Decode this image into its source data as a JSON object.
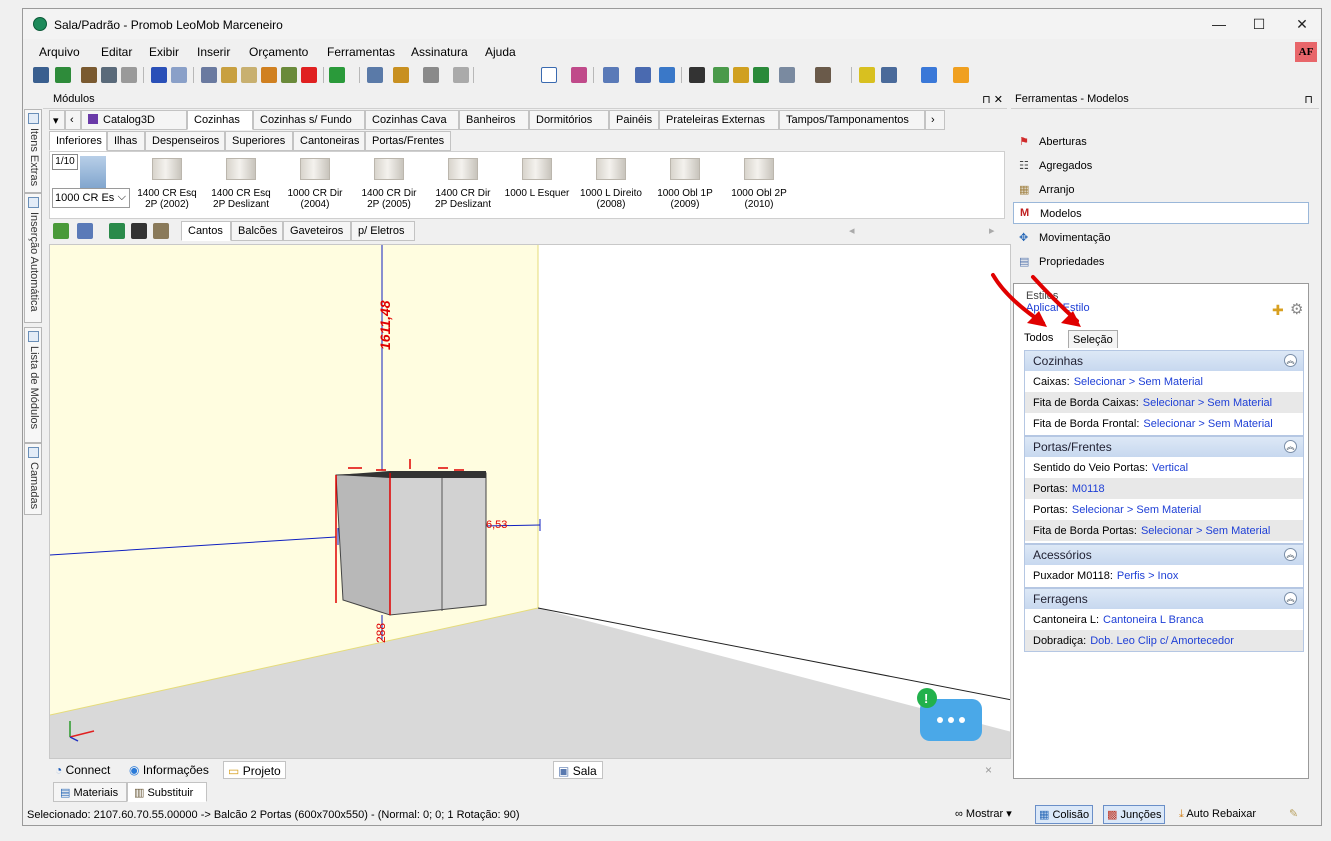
{
  "window": {
    "title": "Sala/Padrão - Promob LeoMob Marceneiro",
    "user_badge": "AF"
  },
  "menu": [
    "Arquivo",
    "Editar",
    "Exibir",
    "Inserir",
    "Orçamento",
    "Ferramentas",
    "Assinatura",
    "Ajuda"
  ],
  "modules_panel": {
    "title": "Módulos",
    "pin": "⊓ ✕"
  },
  "left_tabs": [
    "Itens Extras",
    "Inserção Automática",
    "Lista de Módulos",
    "Camadas"
  ],
  "catalog_tabs": [
    "Catalog3D",
    "Cozinhas",
    "Cozinhas s/ Fundo",
    "Cozinhas Cava",
    "Banheiros",
    "Dormitórios",
    "Painéis",
    "Prateleiras Externas",
    "Tampos/Tamponamentos"
  ],
  "sub_tabs": [
    "Inferiores",
    "Ilhas",
    "Despenseiros",
    "Superiores",
    "Cantoneiras",
    "Portas/Frentes"
  ],
  "page_indicator": "1/10",
  "module_select": "1000 CR Es",
  "thumbnails": [
    {
      "label": "1400 CR Esq 2P (2002)"
    },
    {
      "label": "1400 CR Esq 2P Deslizant"
    },
    {
      "label": "1000 CR Dir (2004)"
    },
    {
      "label": "1400 CR Dir 2P (2005)"
    },
    {
      "label": "1400 CR Dir 2P Deslizant"
    },
    {
      "label": "1000 L Esquer"
    },
    {
      "label": "1000 L Direito (2008)"
    },
    {
      "label": "1000 Obl 1P (2009)"
    },
    {
      "label": "1000 Obl 2P (2010)"
    }
  ],
  "filter_tabs": [
    "Cantos",
    "Balcões",
    "Gaveteiros",
    "p/ Eletros"
  ],
  "viewport": {
    "dim_vertical": "1611,48",
    "dim_horizontal": "6,53",
    "dim_bottom": "288"
  },
  "bottom_tabs": {
    "connect": "Connect",
    "info": "Informações",
    "project": "Projeto",
    "room": "Sala",
    "close": "×"
  },
  "lower_tabs": [
    "Materiais",
    "Substituir"
  ],
  "status": {
    "selected": "Selecionado: 2107.60.70.55.00000 -> Balcão 2 Portas (600x700x550) - (Normal: 0; 0; 1 Rotação: 90)",
    "show": "Mostrar",
    "collision": "Colisão",
    "joints": "Junções",
    "auto_lower": "Auto Rebaixar"
  },
  "tools_panel": {
    "title": "Ferramentas - Modelos",
    "items": [
      "Aberturas",
      "Agregados",
      "Arranjo",
      "Modelos",
      "Movimentação",
      "Propriedades"
    ],
    "styles_label": "Estilos",
    "apply_style": "Aplicar Estilo",
    "tabs": [
      "Todos",
      "Seleção"
    ],
    "groups": [
      {
        "title": "Cozinhas",
        "rows": [
          {
            "label": "Caixas:",
            "value": "Selecionar > Sem Material"
          },
          {
            "label": "Fita de Borda Caixas:",
            "value": "Selecionar > Sem Material"
          },
          {
            "label": "Fita de Borda Frontal:",
            "value": "Selecionar > Sem Material"
          }
        ]
      },
      {
        "title": "Portas/Frentes",
        "rows": [
          {
            "label": "Sentido do Veio Portas:",
            "value": "Vertical"
          },
          {
            "label": "Portas:",
            "value": "M0118"
          },
          {
            "label": "Portas:",
            "value": "Selecionar > Sem Material"
          },
          {
            "label": "Fita de Borda Portas:",
            "value": "Selecionar > Sem Material"
          }
        ]
      },
      {
        "title": "Acessórios",
        "rows": [
          {
            "label": "Puxador M0118:",
            "value": "Perfis > Inox"
          }
        ]
      },
      {
        "title": "Ferragens",
        "rows": [
          {
            "label": "Cantoneira L:",
            "value": "Cantoneira L Branca"
          },
          {
            "label": "Dobradiça:",
            "value": "Dob. Leo Clip c/ Amortecedor"
          }
        ]
      }
    ]
  },
  "colors": {
    "accent": "#1e3fd6",
    "wall": "#fffde0",
    "floor": "#d9d9d9",
    "annotation": "#e00000"
  }
}
